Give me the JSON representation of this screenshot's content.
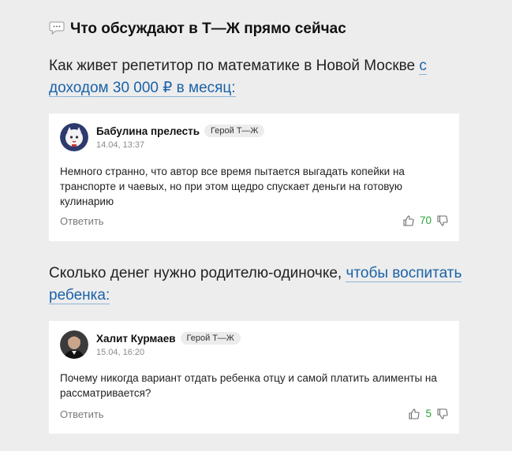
{
  "section": {
    "title": "Что обсуждают в Т—Ж прямо сейчас",
    "emoji_icon": "speech-balloon-icon"
  },
  "posts": [
    {
      "intro_text": "Как живет репетитор по математике в Новой Москве ",
      "link_text": "с доходом 30 000 ₽ в месяц:",
      "comment": {
        "author": "Бабулина прелесть",
        "badge": "Герой Т—Ж",
        "date": "14.04, 13:37",
        "text": "Немного странно, что автор все время пытается выгадать копейки на транспорте и чаевых, но при этом щедро спускает деньги на готовую кулинарию",
        "reply_label": "Ответить",
        "votes": "70"
      }
    },
    {
      "intro_text": "Сколько денег нужно родителю-одиночке, ",
      "link_text": "чтобы воспитать ребенка:",
      "comment": {
        "author": "Халит Курмаев",
        "badge": "Герой Т—Ж",
        "date": "15.04, 16:20",
        "text": "Почему никогда вариант отдать ребенка отцу и самой платить алименты на рассматривается?",
        "reply_label": "Ответить",
        "votes": "5"
      }
    }
  ],
  "colors": {
    "background": "#ededed",
    "link": "#1a62a8",
    "vote_positive": "#2aa336"
  }
}
